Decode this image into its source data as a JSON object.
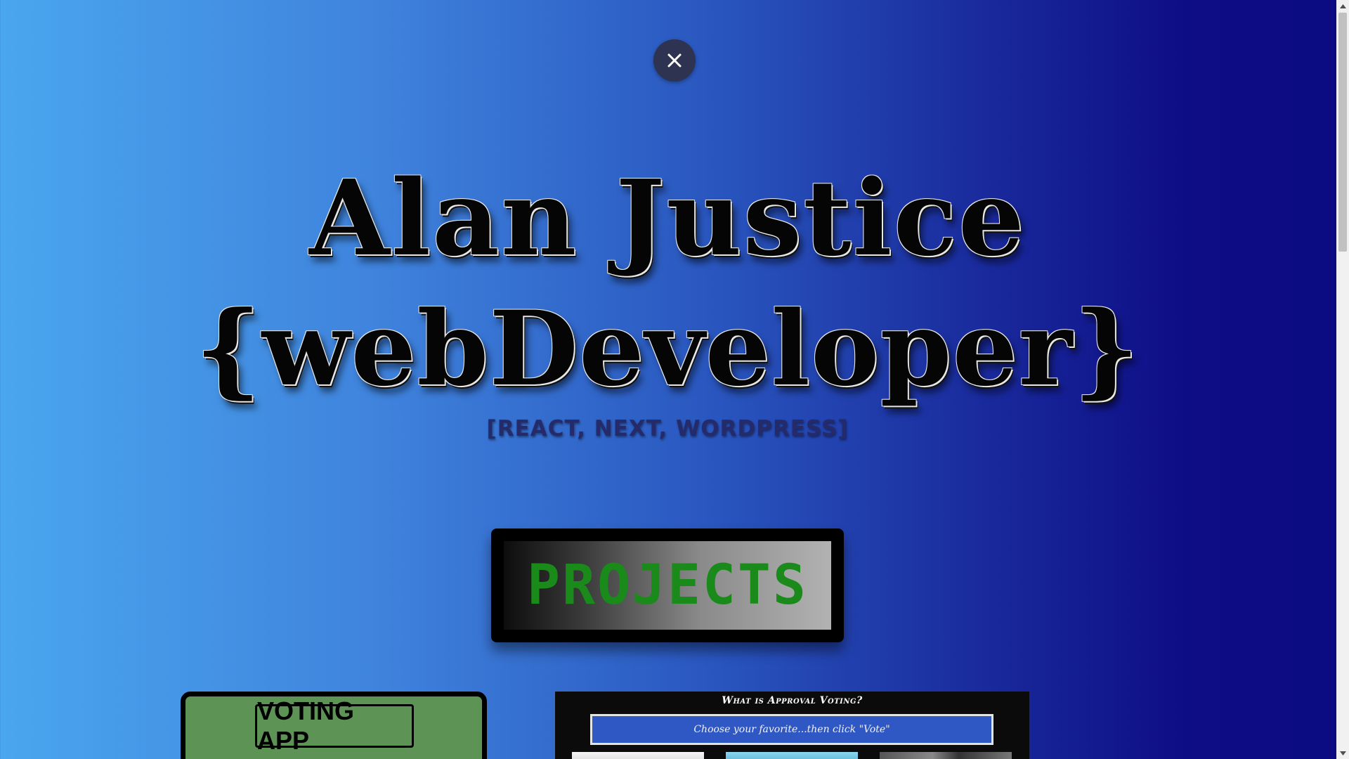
{
  "close_button": {
    "icon": "close-icon"
  },
  "hero": {
    "name": "Alan Justice",
    "role": "{webDeveloper}",
    "stack": "[REACT, NEXT, WORDPRESS]"
  },
  "projects": {
    "label": "PROJECTS"
  },
  "cards": {
    "voting": {
      "label": "VOTING APP"
    },
    "approval": {
      "title": "What is Approval Voting?",
      "instruction": "Choose your favorite...then click \"Vote\""
    }
  },
  "colors": {
    "background_left": "#4aa6ee",
    "background_right": "#0c0b80",
    "projects_text": "#1a8a1a",
    "voting_card": "#5e9356",
    "approval_box": "#2f58c4"
  }
}
